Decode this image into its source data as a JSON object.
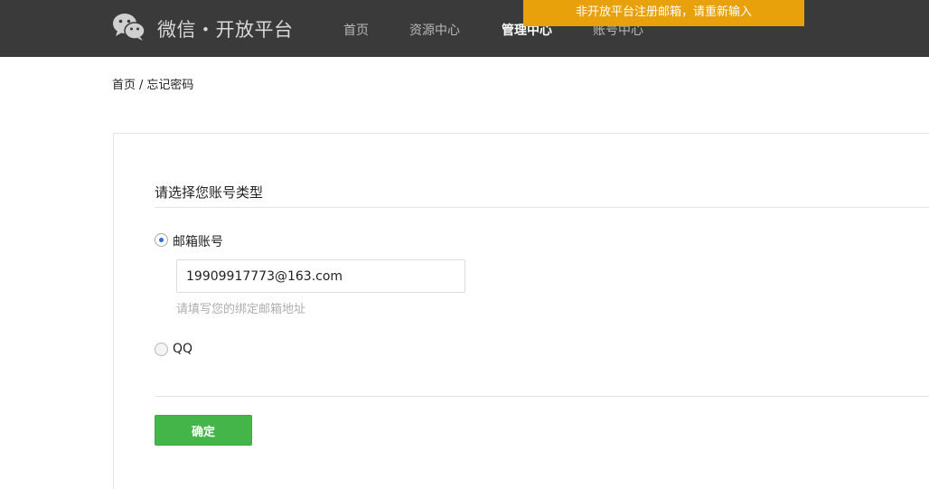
{
  "header": {
    "brand": "微信・开放平台",
    "nav": [
      {
        "label": "首页",
        "active": false
      },
      {
        "label": "资源中心",
        "active": false
      },
      {
        "label": "管理中心",
        "active": true
      },
      {
        "label": "账号中心",
        "active": false
      }
    ]
  },
  "toast": {
    "message": "非开放平台注册邮箱，请重新输入"
  },
  "breadcrumb": {
    "home": "首页",
    "separator": "/",
    "current": "忘记密码"
  },
  "form": {
    "section_title": "请选择您账号类型",
    "email_option": {
      "label": "邮箱账号",
      "checked": true,
      "input_value": "19909917773@163.com",
      "hint": "请填写您的绑定邮箱地址"
    },
    "qq_option": {
      "label": "QQ",
      "checked": false
    },
    "submit_label": "确定"
  },
  "colors": {
    "topbar": "#3a3a3a",
    "toast": "#e9a10b",
    "primary_button": "#44b549",
    "radio_selected": "#2a6fd6"
  }
}
